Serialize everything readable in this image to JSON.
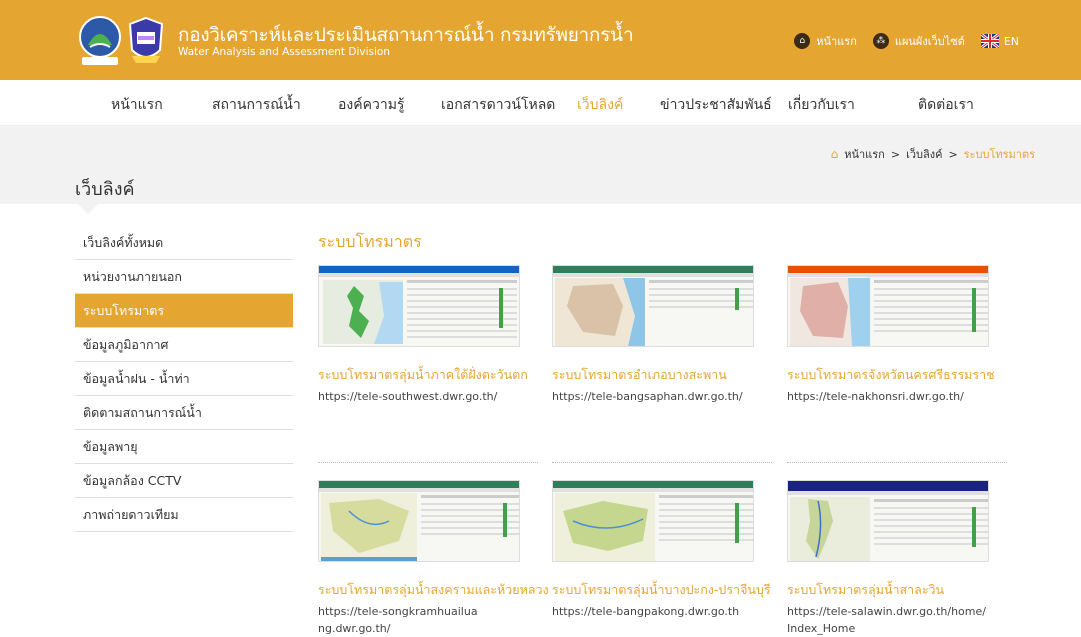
{
  "header": {
    "title": "กองวิเคราะห์และประเมินสถานการณ์น้ำ กรมทรัพยากรน้ำ",
    "subtitle": "Water Analysis and Assessment Division",
    "links": [
      {
        "label": "หน้าแรก",
        "icon": "home-icon"
      },
      {
        "label": "แผนผังเว็บไซต์",
        "icon": "sitemap-icon"
      },
      {
        "label": "EN",
        "icon": "uk-flag-icon"
      }
    ]
  },
  "nav": {
    "items": [
      "หน้าแรก",
      "สถานการณ์น้ำ",
      "องค์ความรู้",
      "เอกสารดาวน์โหลด",
      "เว็บลิงค์",
      "ข่าวประชาสัมพันธ์",
      "เกี่ยวกับเรา",
      "ติดต่อเรา"
    ],
    "active_index": 4
  },
  "page": {
    "title": "เว็บลิงค์",
    "breadcrumb": [
      "หน้าแรก",
      "เว็บลิงค์",
      "ระบบโทรมาตร"
    ]
  },
  "sidebar": {
    "items": [
      "เว็บลิงค์ทั้งหมด",
      "หน่วยงานภายนอก",
      "ระบบโทรมาตร",
      "ข้อมูลภูมิอากาศ",
      "ข้อมูลน้ำฝน - น้ำท่า",
      "ติดตามสถานการณ์น้ำ",
      "ข้อมูลพายุ",
      "ข้อมูลกล้อง CCTV",
      "ภาพถ่ายดาวเทียม"
    ],
    "active_index": 2
  },
  "content": {
    "section_title": "ระบบโทรมาตร",
    "cards": [
      {
        "title": "ระบบโทรมาตรลุ่มน้ำภาคใต้ฝั่งตะวันตก",
        "url": "https://tele-southwest.dwr.go.th/"
      },
      {
        "title": "ระบบโทรมาตรอำเภอบางสะพาน",
        "url": "https://tele-bangsaphan.dwr.go.th/"
      },
      {
        "title": "ระบบโทรมาตรจังหวัดนครศรีธรรมราช",
        "url": "https://tele-nakhonsri.dwr.go.th/"
      },
      {
        "title": "ระบบโทรมาตรลุ่มน้ำสงครามและห้วยหลวง",
        "url": "https://tele-songkramhuailuang.dwr.go.th/"
      },
      {
        "title": "ระบบโทรมาตรลุ่มน้ำบางปะกง-ปราจีนบุรี",
        "url": "https://tele-bangpakong.dwr.go.th"
      },
      {
        "title": "ระบบโทรมาตรลุ่มน้ำสาละวิน",
        "url": "https://tele-salawin.dwr.go.th/home/Index_Home"
      }
    ]
  },
  "colors": {
    "accent": "#e5a531",
    "band": "#f2f2f2"
  }
}
